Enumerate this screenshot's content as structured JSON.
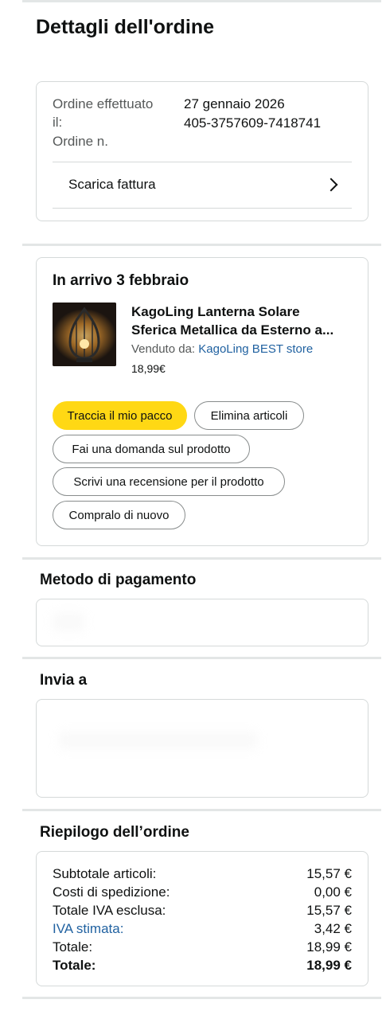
{
  "page": {
    "title": "Dettagli dell'ordine"
  },
  "order_info": {
    "date_label": "Ordine effettuato il:",
    "date_value": "27 gennaio 2026",
    "number_label": "Ordine n.",
    "number_value": "405-3757609-7418741",
    "invoice_label": "Scarica fattura"
  },
  "shipment": {
    "heading": "In arrivo 3 febbraio",
    "product": {
      "title_line1": "KagoLing Lanterna Solare",
      "title_line2": "Sferica Metallica da Esterno a...",
      "sold_by_label": "Venduto da:",
      "seller": "KagoLing BEST store",
      "price": "18,99€"
    },
    "actions": {
      "track": "Traccia il mio pacco",
      "delete": "Elimina articoli",
      "ask": "Fai una domanda sul prodotto",
      "review": "Scrivi una recensione per il prodotto",
      "buy_again": "Compralo di nuovo"
    }
  },
  "payment": {
    "heading": "Metodo di pagamento"
  },
  "shipping": {
    "heading": "Invia a"
  },
  "summary": {
    "heading": "Riepilogo dell’ordine",
    "rows": [
      {
        "label": "Subtotale articoli:",
        "value": "15,57 €"
      },
      {
        "label": "Costi di spedizione:",
        "value": "0,00 €"
      },
      {
        "label": "Totale IVA esclusa:",
        "value": "15,57 €"
      },
      {
        "label": "IVA stimata:",
        "value": "3,42 €"
      },
      {
        "label": "Totale:",
        "value": "18,99 €"
      },
      {
        "label": "Totale:",
        "value": "18,99 €"
      }
    ]
  },
  "colors": {
    "primary_button": "#ffd814",
    "link": "#2162a1",
    "border": "#d5d9d9",
    "separator": "#e3e6e6"
  },
  "icons": {
    "invoice_chevron": "chevron-right-icon"
  }
}
